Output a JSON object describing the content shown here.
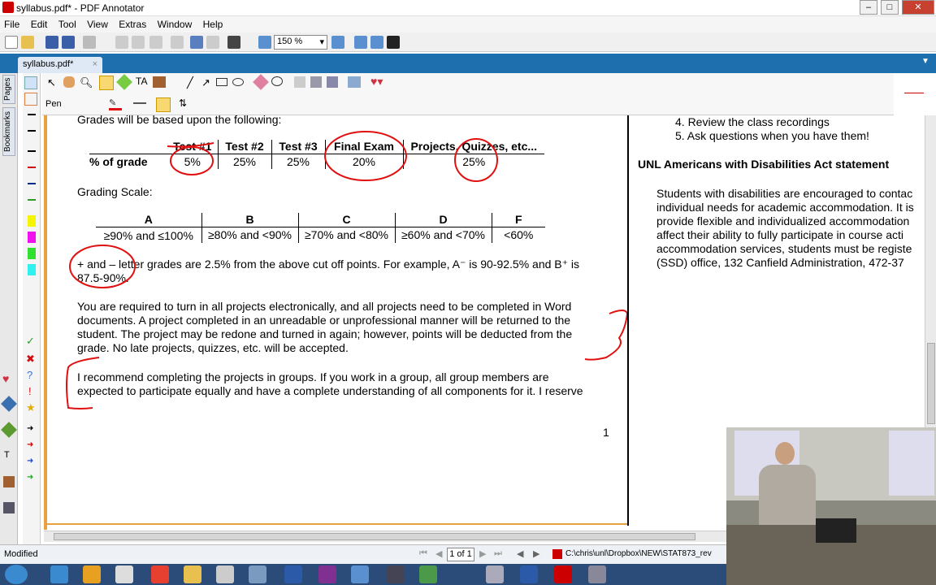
{
  "window": {
    "title": "syllabus.pdf* - PDF Annotator",
    "controls": [
      "–",
      "□",
      "✕"
    ]
  },
  "menu": [
    "File",
    "Edit",
    "Tool",
    "View",
    "Extras",
    "Window",
    "Help"
  ],
  "toolbar": {
    "zoom": "150 %"
  },
  "tab": {
    "label": "syllabus.pdf*",
    "close": "×"
  },
  "side_tabs": [
    "Pages",
    "Bookmarks"
  ],
  "tool_options": {
    "pen_label": "Pen"
  },
  "grades": {
    "intro": "Grades will be based upon the following:",
    "headers": [
      "Test #1",
      "Test #2",
      "Test #3",
      "Final Exam",
      "Projects, Quizzes, etc..."
    ],
    "row_label": "% of grade",
    "values": [
      "5%",
      "25%",
      "25%",
      "20%",
      "25%"
    ]
  },
  "scale": {
    "title": "Grading Scale:",
    "headers": [
      "A",
      "B",
      "C",
      "D",
      "F"
    ],
    "values": [
      "≥90% and ≤100%",
      "≥80% and <90%",
      "≥70% and <80%",
      "≥60% and <70%",
      "<60%"
    ]
  },
  "para1": {
    "line1": "+ and – letter grades are 2.5% from the above cut off points. For example, A⁻ is 90-92.5% and B⁺ is",
    "line2": "87.5-90%."
  },
  "para2": [
    "You are required to turn in all projects electronically, and all projects need to be completed in Word",
    "documents. A project completed in an unreadable or unprofessional manner will be returned to the",
    "student. The project may be redone and turned in again; however, points will be deducted from the",
    "grade. No late projects, quizzes, etc. will be accepted."
  ],
  "para3": [
    "I recommend completing the projects in groups. If you work in a group, all group members are",
    "expected to participate equally and have a complete understanding of all components for it. I reserve"
  ],
  "page_number": "1",
  "right_page": {
    "list": [
      "4.  Review the class recordings",
      "5.  Ask questions when you have them!"
    ],
    "heading": "UNL Americans with Disabilities Act statement",
    "body": [
      "Students with disabilities are encouraged to contac",
      "individual needs for academic accommodation. It is",
      "provide flexible and individualized accommodation",
      "affect their ability to fully participate in course acti",
      "accommodation services, students must be registe",
      "(SSD) office, 132 Canfield Administration, 472-37"
    ]
  },
  "status": {
    "text": "Modified",
    "page": "1 of 1",
    "path": "C:\\chris\\unl\\Dropbox\\NEW\\STAT873_rev"
  },
  "taskbar": {
    "start": "start-orb"
  },
  "colors": {
    "annotation": "#e01010",
    "tab_blue": "#1e6fae",
    "page_border": "#e8a040"
  }
}
